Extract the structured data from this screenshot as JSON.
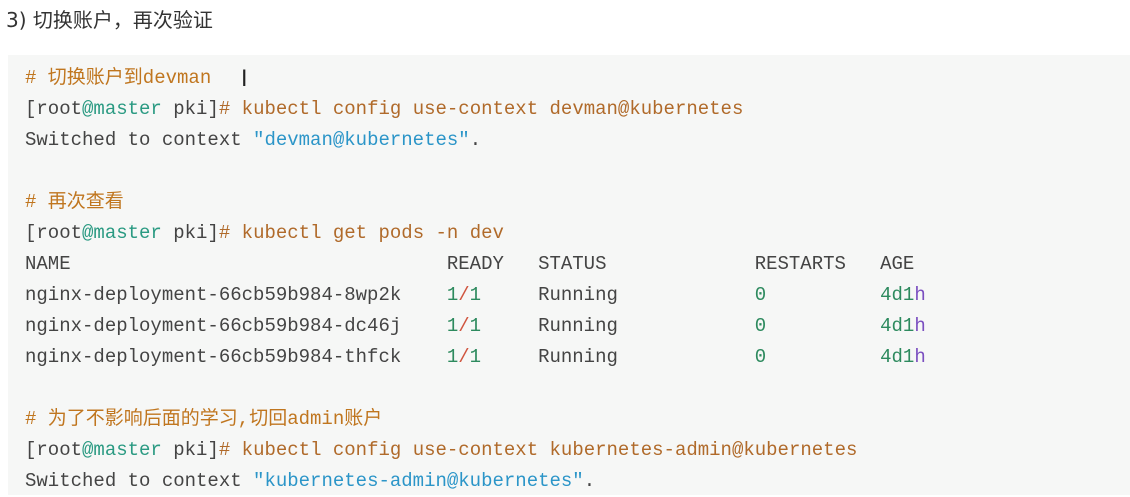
{
  "heading": "3) 切换账户，再次验证",
  "code": {
    "comment1": "# 切换账户到devman",
    "prompt": {
      "open": "[root",
      "host": "@master",
      "dir": " pki]",
      "hash": "#"
    },
    "cmd1": " kubectl config use-context devman@kubernetes",
    "out1_prefix": "Switched to context ",
    "out1_ctx": "\"devman@kubernetes\"",
    "out1_suffix": ".",
    "comment2": "# 再次查看",
    "cmd2": " kubectl get pods -n dev",
    "table": {
      "headers": [
        "NAME",
        "READY",
        "STATUS",
        "RESTARTS",
        "AGE"
      ],
      "rows": [
        {
          "name": "nginx-deployment-66cb59b984-8wp2k",
          "ready_a": "1",
          "ready_b": "1",
          "status": "Running",
          "restarts": "0",
          "age_num": "4d1",
          "age_h": "h"
        },
        {
          "name": "nginx-deployment-66cb59b984-dc46j",
          "ready_a": "1",
          "ready_b": "1",
          "status": "Running",
          "restarts": "0",
          "age_num": "4d1",
          "age_h": "h"
        },
        {
          "name": "nginx-deployment-66cb59b984-thfck",
          "ready_a": "1",
          "ready_b": "1",
          "status": "Running",
          "restarts": "0",
          "age_num": "4d1",
          "age_h": "h"
        }
      ]
    },
    "comment3": "# 为了不影响后面的学习,切回admin账户",
    "cmd3": " kubectl config use-context kubernetes-admin@kubernetes",
    "out3_prefix": "Switched to context ",
    "out3_ctx": "\"kubernetes-admin@kubernetes\"",
    "out3_suffix": "."
  },
  "cursor_glyph": "I"
}
